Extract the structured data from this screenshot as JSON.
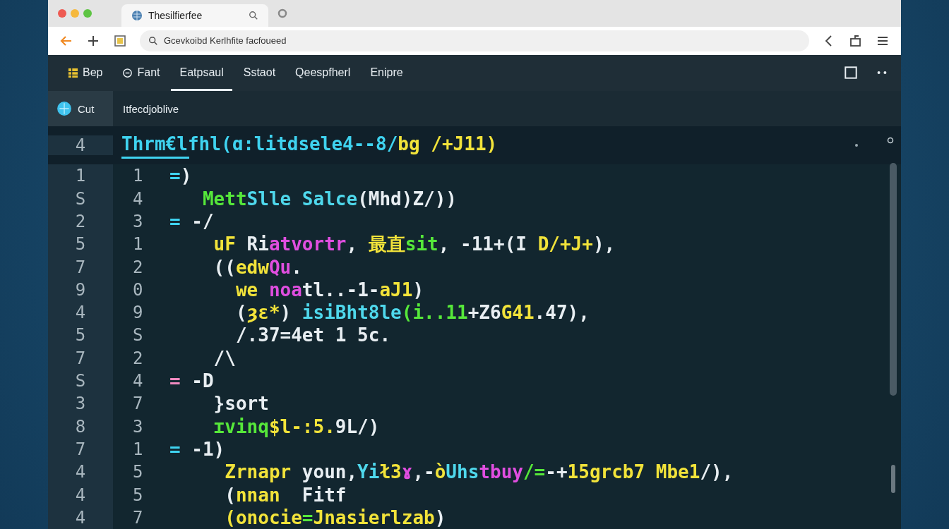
{
  "browser": {
    "tab": {
      "title": "Thesilfierfee"
    },
    "address": "Gcevkoibd Kerlhfite facfoueed"
  },
  "toolbar": {
    "items": [
      {
        "label": "Bep",
        "kind": "grid",
        "selected": false
      },
      {
        "label": "Fant",
        "kind": "circle",
        "selected": false
      },
      {
        "label": "Eatpsaul",
        "kind": "plain",
        "selected": true
      },
      {
        "label": "Sstaot",
        "kind": "plain",
        "selected": false
      },
      {
        "label": "Qeespfherl",
        "kind": "plain",
        "selected": false
      },
      {
        "label": "Enipre",
        "kind": "plain",
        "selected": false
      }
    ]
  },
  "sidebar": {
    "item": {
      "label": "Cut",
      "selected": true
    }
  },
  "document": {
    "title": "Itfecdjoblive"
  },
  "editor": {
    "header": {
      "outer_number": "4",
      "tokens": [
        {
          "text": "Thrm€lfhl(ɑ:litdsele4--8/",
          "color": "#3fd3f0"
        },
        {
          "text": "bg /+J11)",
          "color": "#f2e33a"
        }
      ]
    },
    "rows": [
      {
        "outer": "1",
        "inner": "1",
        "tokens": [
          {
            "text": "=",
            "color": "#3fd3f0"
          },
          {
            "text": ")",
            "color": "#e8eef2"
          }
        ]
      },
      {
        "outer": "S",
        "inner": "4",
        "tokens": [
          {
            "text": "   Mett",
            "color": "#56e83a"
          },
          {
            "text": "Slle Salce",
            "color": "#4fd8ec"
          },
          {
            "text": "(Mhd)Z/))",
            "color": "#e8eef2"
          }
        ]
      },
      {
        "outer": "2",
        "inner": "3",
        "tokens": [
          {
            "text": "= ",
            "color": "#3fd3f0"
          },
          {
            "text": "-/",
            "color": "#e8eef2"
          }
        ]
      },
      {
        "outer": "5",
        "inner": "1",
        "tokens": [
          {
            "text": "    uF",
            "color": "#f2e33a"
          },
          {
            "text": " Ri",
            "color": "#e8eef2"
          },
          {
            "text": "atvortr",
            "color": "#e04ee0"
          },
          {
            "text": ", ",
            "color": "#e8eef2"
          },
          {
            "text": "最直",
            "color": "#f2e33a"
          },
          {
            "text": "sit",
            "color": "#56e83a"
          },
          {
            "text": ", -11+(I",
            "color": "#e8eef2"
          },
          {
            "text": " D/+J+",
            "color": "#f2e33a"
          },
          {
            "text": "),",
            "color": "#e8eef2"
          }
        ]
      },
      {
        "outer": "7",
        "inner": "2",
        "tokens": [
          {
            "text": "    ((",
            "color": "#e8eef2"
          },
          {
            "text": "edw",
            "color": "#f2e33a"
          },
          {
            "text": "Qu",
            "color": "#e04ee0"
          },
          {
            "text": ".",
            "color": "#e8eef2"
          }
        ]
      },
      {
        "outer": "9",
        "inner": "0",
        "tokens": [
          {
            "text": "      we ",
            "color": "#f2e33a"
          },
          {
            "text": "noa",
            "color": "#e04ee0"
          },
          {
            "text": "tl..-1-",
            "color": "#e8eef2"
          },
          {
            "text": "aJ1",
            "color": "#f2e33a"
          },
          {
            "text": ")",
            "color": "#e8eef2"
          }
        ]
      },
      {
        "outer": "4",
        "inner": "9",
        "tokens": [
          {
            "text": "      (",
            "color": "#e8eef2"
          },
          {
            "text": "ȝε*",
            "color": "#f2e33a"
          },
          {
            "text": ") ",
            "color": "#e8eef2"
          },
          {
            "text": "isiBht8le",
            "color": "#4fd8ec"
          },
          {
            "text": "(i..11",
            "color": "#56e83a"
          },
          {
            "text": "+Z6",
            "color": "#e8eef2"
          },
          {
            "text": "G41",
            "color": "#f2e33a"
          },
          {
            "text": ".47),",
            "color": "#e8eef2"
          }
        ]
      },
      {
        "outer": "5",
        "inner": "S",
        "tokens": [
          {
            "text": "      /.37=4et 1 5c.",
            "color": "#e8eef2"
          }
        ]
      },
      {
        "outer": "7",
        "inner": "2",
        "tokens": [
          {
            "text": "    /\\",
            "color": "#e8eef2"
          }
        ]
      },
      {
        "outer": "S",
        "inner": "4",
        "tokens": [
          {
            "text": "=",
            "color": "#f08ac0"
          },
          {
            "text": " -D",
            "color": "#e8eef2"
          }
        ]
      },
      {
        "outer": "3",
        "inner": "7",
        "tokens": [
          {
            "text": "    }sort",
            "color": "#e8eef2"
          }
        ]
      },
      {
        "outer": "8",
        "inner": "3",
        "tokens": [
          {
            "text": "    ɪvinq",
            "color": "#56e83a"
          },
          {
            "text": "$l-:5.",
            "color": "#f2e33a"
          },
          {
            "text": "9L/)",
            "color": "#e8eef2"
          }
        ]
      },
      {
        "outer": "7",
        "inner": "1",
        "tokens": [
          {
            "text": "=",
            "color": "#3fd3f0"
          },
          {
            "text": " -1)",
            "color": "#e8eef2"
          }
        ]
      },
      {
        "outer": "4",
        "inner": "5",
        "tokens": [
          {
            "text": "     Zrnapr",
            "color": "#f2e33a"
          },
          {
            "text": " youn,",
            "color": "#e8eef2"
          },
          {
            "text": "Yi",
            "color": "#4fd8ec"
          },
          {
            "text": "ł3",
            "color": "#f2e33a"
          },
          {
            "text": "ɤ",
            "color": "#e04ee0"
          },
          {
            "text": ",-",
            "color": "#e8eef2"
          },
          {
            "text": "ò",
            "color": "#f2e33a"
          },
          {
            "text": "Uhs",
            "color": "#4fd8ec"
          },
          {
            "text": "tbuy",
            "color": "#e04ee0"
          },
          {
            "text": "/=",
            "color": "#56e83a"
          },
          {
            "text": "-+",
            "color": "#e8eef2"
          },
          {
            "text": "15grcb7 Mbe1",
            "color": "#f2e33a"
          },
          {
            "text": "/),",
            "color": "#e8eef2"
          }
        ]
      },
      {
        "outer": "4",
        "inner": "5",
        "tokens": [
          {
            "text": "     (",
            "color": "#e8eef2"
          },
          {
            "text": "nnan",
            "color": "#f2e33a"
          },
          {
            "text": "  Fitf",
            "color": "#e8eef2"
          }
        ]
      },
      {
        "outer": "4",
        "inner": "7",
        "tokens": [
          {
            "text": "     (onocie",
            "color": "#f2e33a"
          },
          {
            "text": "=",
            "color": "#56e83a"
          },
          {
            "text": "Jnasierlzab",
            "color": "#f2e33a"
          },
          {
            "text": ")",
            "color": "#e8eef2"
          }
        ]
      }
    ]
  }
}
